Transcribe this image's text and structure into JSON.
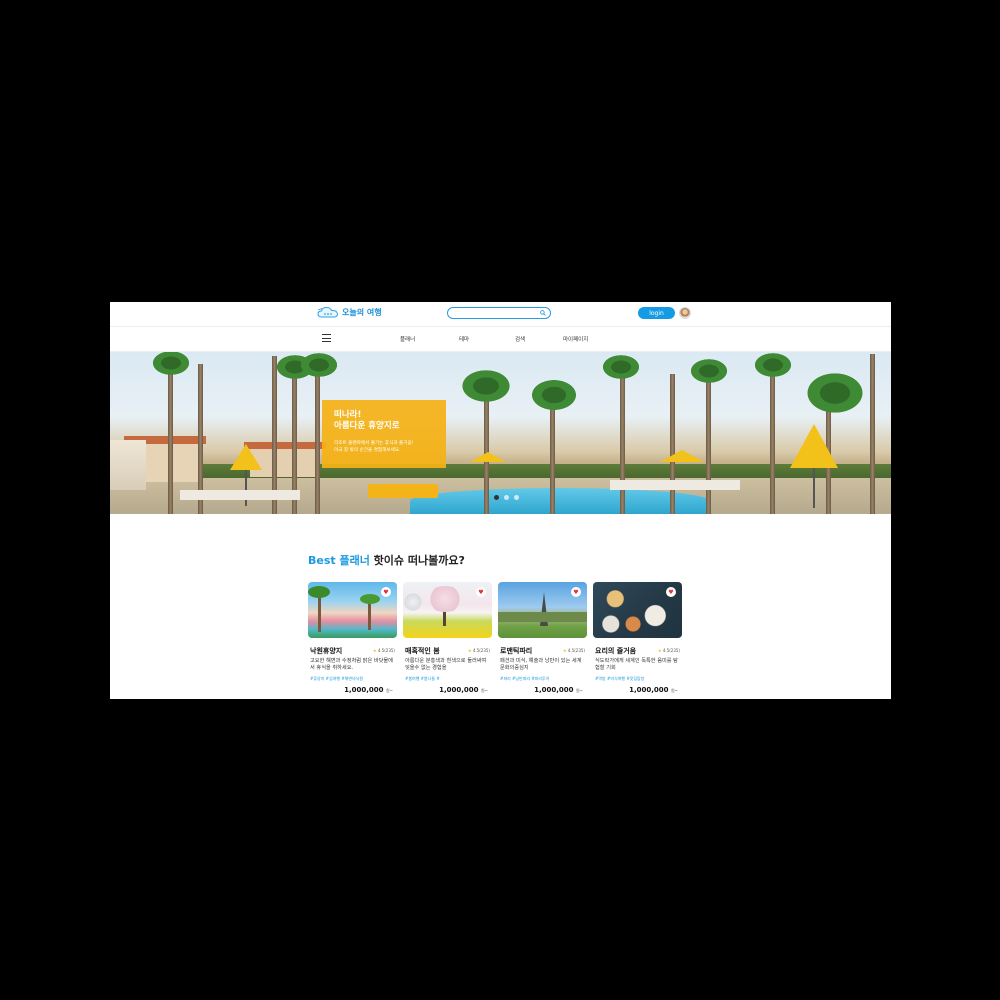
{
  "header": {
    "logo_text": "오늘의 여행",
    "search_placeholder": "",
    "login_label": "login"
  },
  "nav": {
    "items": [
      {
        "label": "플래너"
      },
      {
        "label": "테마"
      },
      {
        "label": "검색"
      },
      {
        "label": "마이페이지"
      }
    ]
  },
  "hero": {
    "title_line1": "떠나라!",
    "title_line2": "아름다운 휴양지로",
    "desc_line1": "리조트 플랜따에서 즐기는 휴식과 즐거움!",
    "desc_line2": "이국 창 밖의 순간을 경험해보세요."
  },
  "best": {
    "title_blue": "Best 플래너",
    "title_rest": " 핫이슈 떠나볼까요?",
    "cards": [
      {
        "title": "낙원휴양지",
        "rating": "4.5(235)",
        "desc": "고요한 해변과 수정처럼 맑은 바닷물에서 휴식을 취하세요.",
        "tags": "#휴양지 #섬여행 #해변의낙원",
        "price": "1,000,000",
        "unit": "원~"
      },
      {
        "title": "매혹적인 봄",
        "rating": "4.5(235)",
        "desc": "아름다운 분홍색과 흰색으로 둘러싸여 잊을수 없는 경험을",
        "tags": "#봄여행 #봄나들 #",
        "price": "1,000,000",
        "unit": "원~"
      },
      {
        "title": "로맨틱파리",
        "rating": "4.5(235)",
        "desc": "패션과 미식, 예술과 낭만이 있는 세계 문화의중심지",
        "tags": "#파리 #낭만파리 #파리투어",
        "price": "1,000,000",
        "unit": "원~"
      },
      {
        "title": "요리의 즐거움",
        "rating": "4.5(235)",
        "desc": "식도락가에게 세계인 독특한 음미를 탐험할 기회",
        "tags": "#먹방 #미식여행 #맛집탐방",
        "price": "1,000,000",
        "unit": "원~"
      }
    ]
  }
}
